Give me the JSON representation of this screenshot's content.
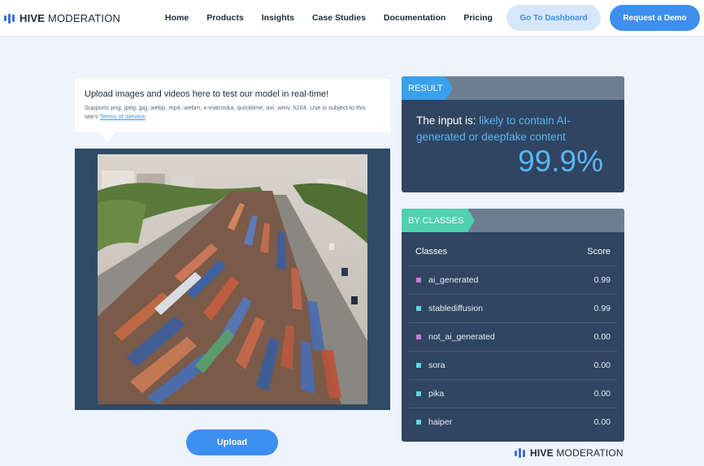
{
  "nav": {
    "brand_bold": "HIVE",
    "brand_light": " MODERATION",
    "links": [
      "Home",
      "Products",
      "Insights",
      "Case Studies",
      "Documentation",
      "Pricing"
    ],
    "dashboard_label": "Go To Dashboard",
    "demo_label": "Request a Demo"
  },
  "upload": {
    "title": "Upload images and videos here to test our model in real-time!",
    "subtitle": "Supports png, jpeg, jpg, webp, mp4, webm, x-matroska, quicktime, avi, wmv, h264. Use is subject to this site's ",
    "terms_link": "Terms of Service",
    "subtitle_end": ".",
    "button_label": "Upload"
  },
  "result": {
    "tag": "RESULT",
    "prefix": "The input is: ",
    "verdict": "likely to contain AI-generated or deepfake content",
    "percent": "99.9%"
  },
  "classes": {
    "tag": "BY CLASSES",
    "col_class": "Classes",
    "col_score": "Score",
    "rows": [
      {
        "name": "ai_generated",
        "score": "0.99",
        "color": "#c77dd6"
      },
      {
        "name": "stablediffusion",
        "score": "0.99",
        "color": "#5fd3e3"
      },
      {
        "name": "not_ai_generated",
        "score": "0.00",
        "color": "#c77dd6"
      },
      {
        "name": "sora",
        "score": "0.00",
        "color": "#5fd3e3"
      },
      {
        "name": "pika",
        "score": "0.00",
        "color": "#5fd3e3"
      },
      {
        "name": "haiper",
        "score": "0.00",
        "color": "#5fd3e3"
      }
    ]
  },
  "footer": {
    "brand_bold": "HIVE",
    "brand_light": " MODERATION"
  },
  "colors": {
    "accent": "#3d8ff0",
    "card_bg": "#2f4561",
    "result_tag": "#3aa0ec",
    "classes_tag": "#4fd0b0"
  }
}
